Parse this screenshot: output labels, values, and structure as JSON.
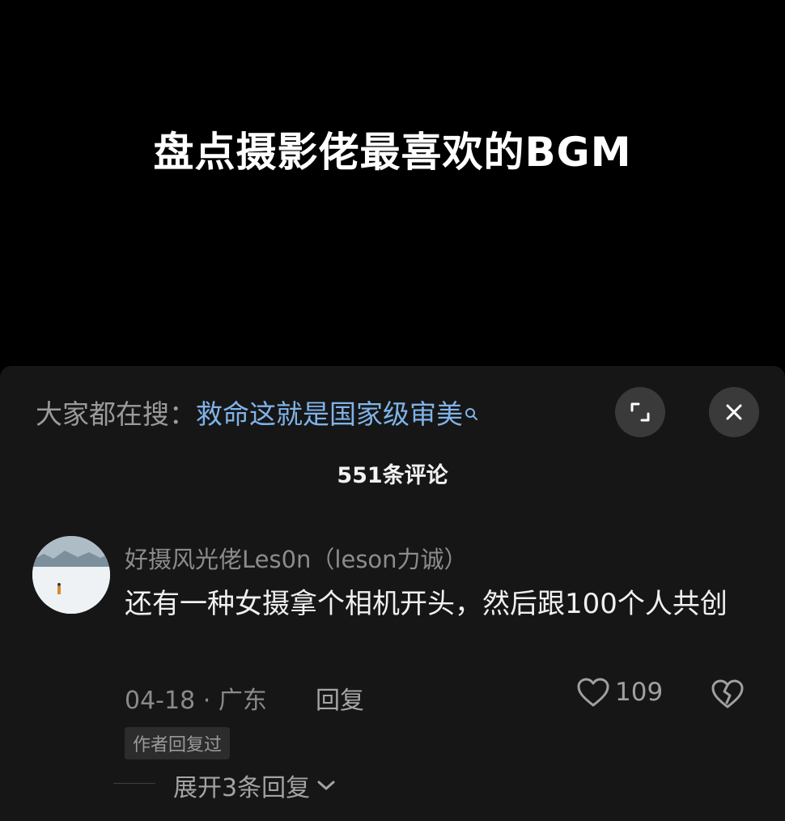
{
  "video": {
    "title": "盘点摄影佬最喜欢的BGM"
  },
  "search": {
    "prefix": "大家都在搜：",
    "term": "救命这就是国家级审美",
    "icon": "search-icon"
  },
  "controls": {
    "expand_icon": "expand-icon",
    "close_icon": "close-icon"
  },
  "comments": {
    "count_label": "551条评论",
    "items": [
      {
        "username": "好摄风光佬Les0n（leson力诚）",
        "text": "还有一种女摄拿个相机开头，然后跟100个人共创",
        "date": "04-18",
        "separator": "·",
        "location": "广东",
        "reply_label": "回复",
        "likes": "109",
        "author_badge": "作者回复过",
        "expand_replies": "展开3条回复"
      }
    ]
  },
  "colors": {
    "background": "#000000",
    "panel": "#161616",
    "search_link": "#7fb3e8",
    "button_bg": "#3a3a3a"
  }
}
